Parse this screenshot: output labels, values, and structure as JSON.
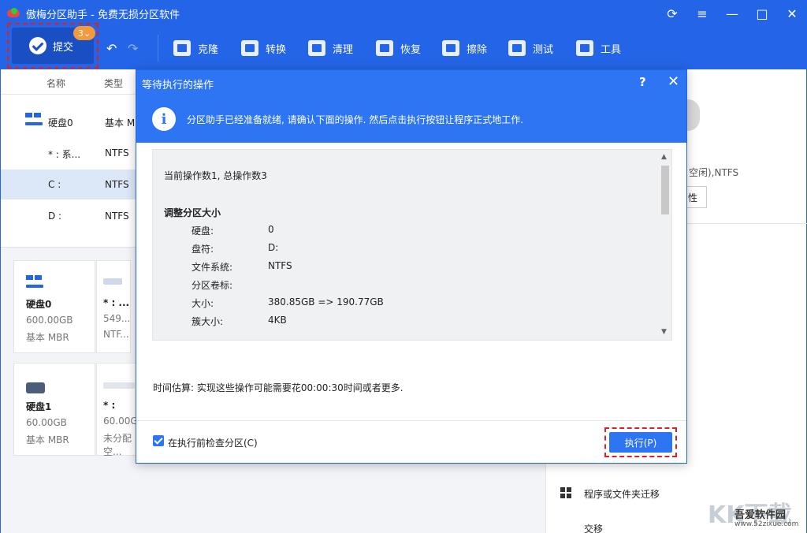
{
  "app": {
    "title": "傲梅分区助手 - 免费无损分区软件"
  },
  "window_controls": [
    "⟳",
    "≡",
    "—",
    "□",
    "✕"
  ],
  "toolbar": {
    "commit_label": "提交",
    "commit_badge": "3",
    "undo": "↶",
    "redo": "↷",
    "tools": [
      "克隆",
      "转换",
      "清理",
      "恢复",
      "擦除",
      "测试",
      "工具"
    ]
  },
  "table": {
    "headers": [
      "名称",
      "类型"
    ],
    "rows": [
      {
        "name": "硬盘0",
        "type": "基本 M"
      },
      {
        "name": "* : 系...",
        "type": "NTFS"
      },
      {
        "name": "C :",
        "type": "NTFS"
      },
      {
        "name": "D :",
        "type": "NTFS"
      }
    ]
  },
  "disk_cards": [
    {
      "title": "硬盘0",
      "size": "600.00GB",
      "kind": "基本 MBR",
      "part_label": "* : ...",
      "part_size": "549...",
      "part_fs": "NTF..."
    },
    {
      "title": "硬盘1",
      "size": "60.00GB",
      "kind": "基本 MBR",
      "part_label": "* :",
      "part_size": "60.00GB",
      "part_fs": "未分配空..."
    }
  ],
  "right_pane": {
    "fs_text": "空闲),NTFS",
    "btn_label": "性",
    "migrate_label": "程序或文件夹迁移",
    "next_label": "交移"
  },
  "dialog": {
    "title": "等待执行的操作",
    "help": "?",
    "close": "✕",
    "message": "分区助手已经准备就绪, 请确认下面的操作. 然后点击执行按钮让程序正式地工作.",
    "summary": "当前操作数1, 总操作数3",
    "op_title": "调整分区大小",
    "op_details": [
      {
        "k": "硬盘:",
        "v": "0"
      },
      {
        "k": "盘符:",
        "v": "D:"
      },
      {
        "k": "文件系统:",
        "v": "NTFS"
      },
      {
        "k": "分区卷标:",
        "v": ""
      },
      {
        "k": "大小:",
        "v": "380.85GB => 190.77GB"
      },
      {
        "k": "簇大小:",
        "v": "4KB"
      }
    ],
    "time_estimate": "时间估算: 实现这些操作可能需要花00:00:30时间或者更多.",
    "check_label": "在执行前检查分区(C)",
    "execute_label": "执行(P)"
  },
  "watermark": {
    "big": "KK下载",
    "site": "吾爱软件园",
    "url": "www.52zixue.com"
  }
}
